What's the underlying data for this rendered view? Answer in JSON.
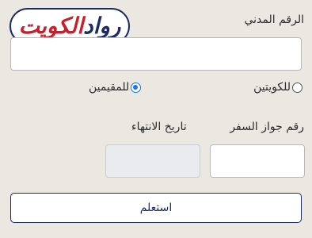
{
  "logo": {
    "part1": "رواد",
    "part2": "الكويت"
  },
  "form": {
    "civil_id_label": "الرقم المدني",
    "civil_id_value": "",
    "residency": {
      "kuwaiti_label": "للكويتين",
      "resident_label": "للمقيمين",
      "selected": "resident"
    },
    "passport_label": "رقم جواز السفر",
    "passport_value": "",
    "expiry_label": "تاريخ الانتهاء",
    "expiry_value": "",
    "submit_label": "استعلم"
  },
  "colors": {
    "brand_navy": "#1c2b63",
    "brand_red": "#c8202b",
    "radio_accent": "#1a73e8",
    "background": "#eae8e1"
  }
}
